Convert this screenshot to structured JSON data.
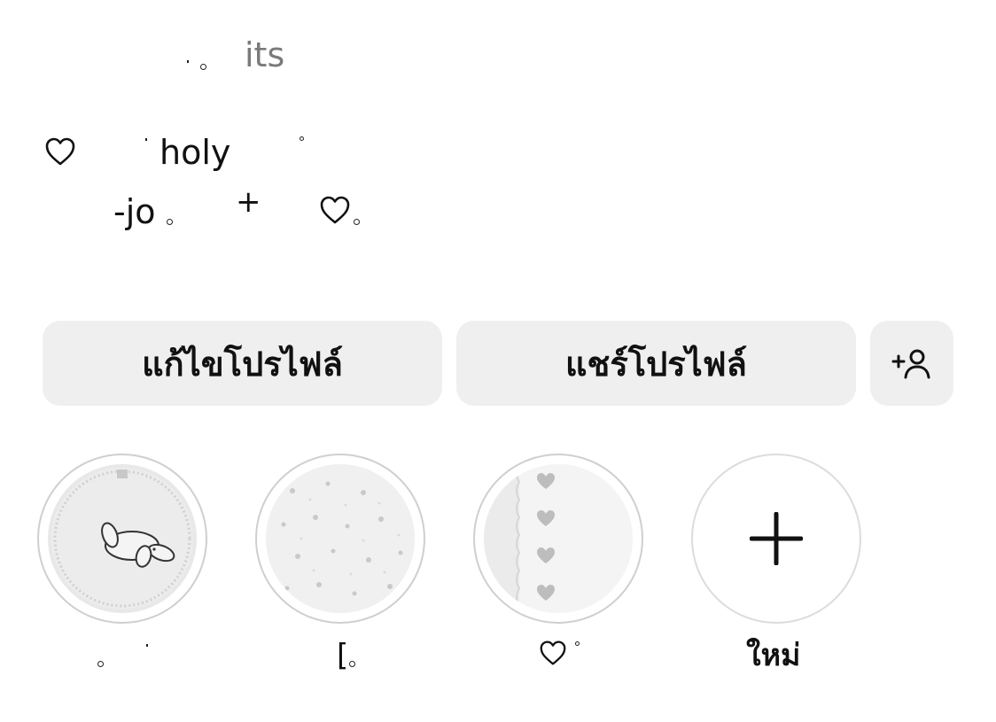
{
  "profile": {
    "handle": "its",
    "bio_line1": "holy",
    "bio_line2": "-jo",
    "bio_symbol": "+"
  },
  "buttons": {
    "edit_profile": "แก้ไขโปรไฟล์",
    "share_profile": "แชร์โปรไฟล์"
  },
  "highlights": [
    {
      "label": "",
      "image": "sleeping-bunny-embroidery"
    },
    {
      "label": "[",
      "image": "floral-pattern"
    },
    {
      "label": "",
      "image": "hearts-lace"
    },
    {
      "label": "ใหม่",
      "image": "plus-icon"
    }
  ],
  "colors": {
    "button_bg": "#efefef",
    "ring": "#cfcfcf",
    "handle_text": "#7a7a7a"
  }
}
